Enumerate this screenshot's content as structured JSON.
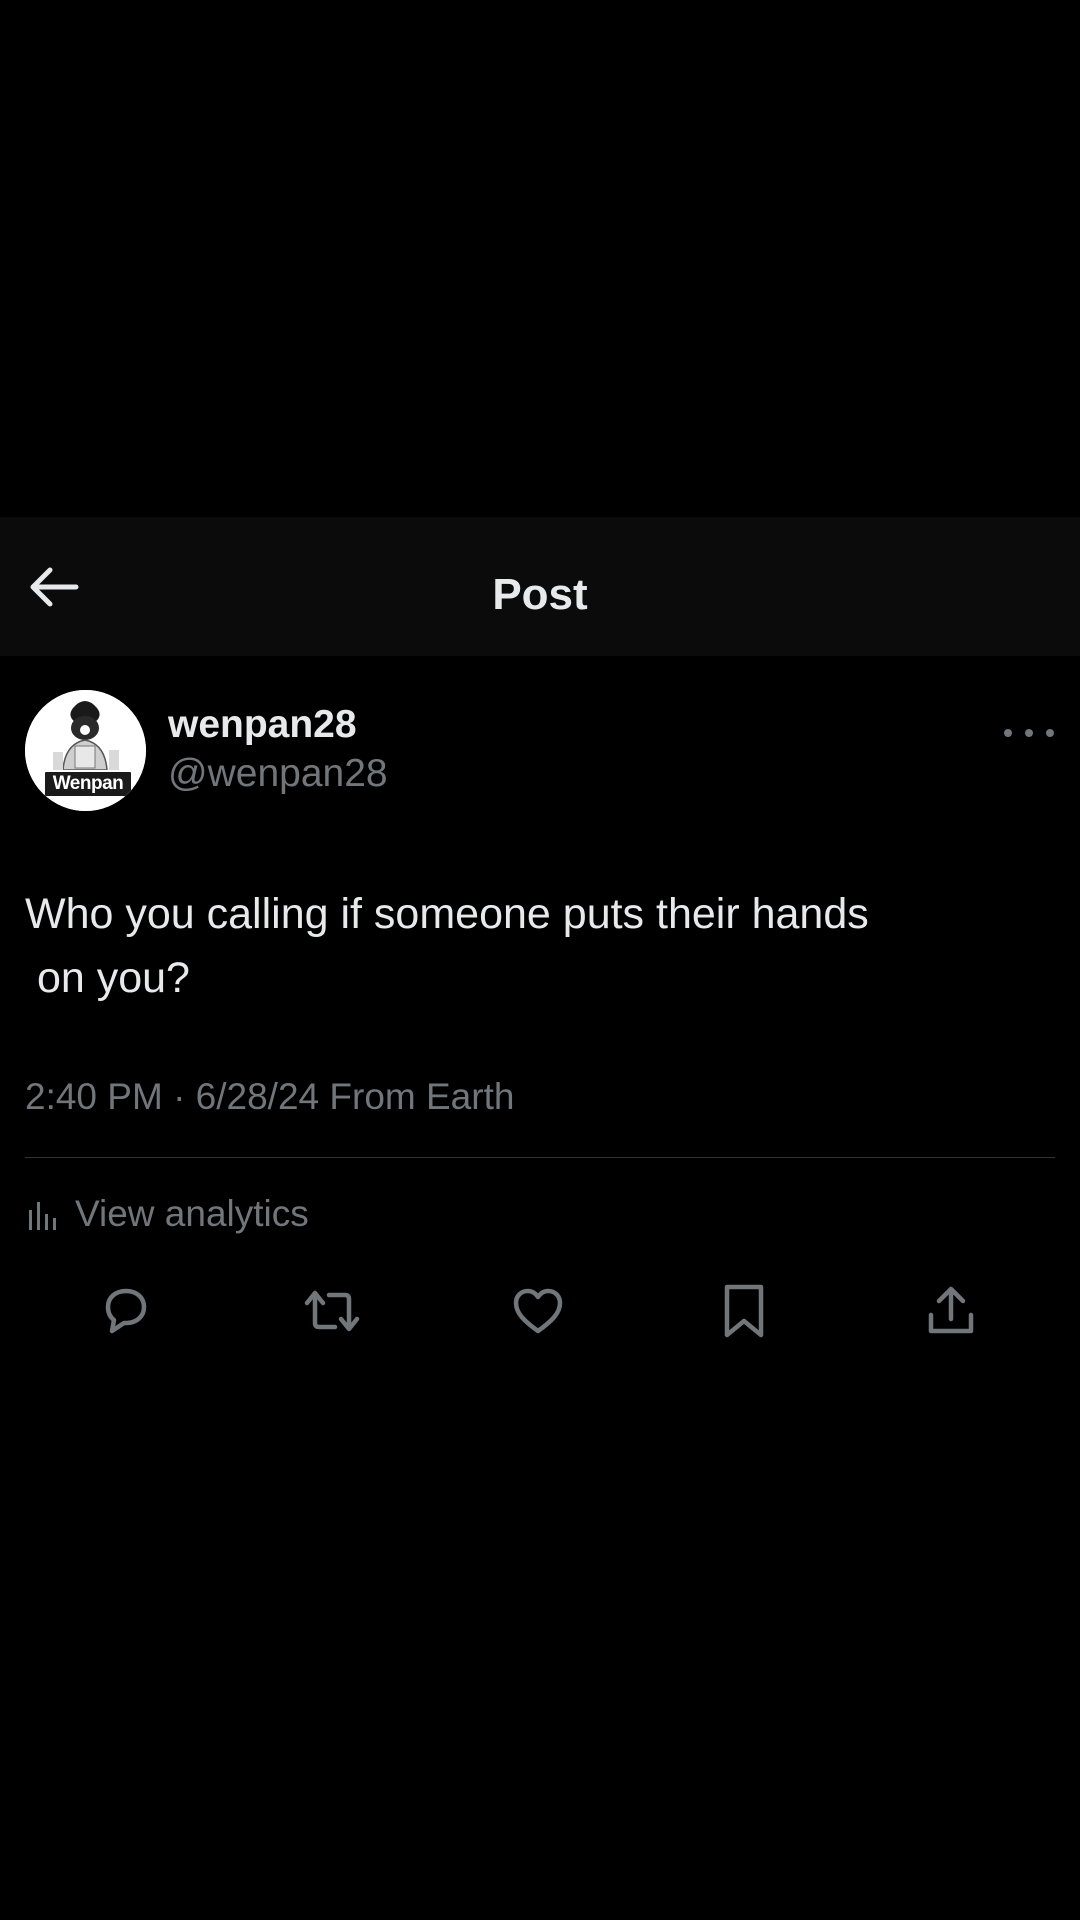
{
  "header": {
    "title": "Post",
    "back_icon": "arrow-left-icon"
  },
  "post": {
    "author": {
      "display_name": "wenpan28",
      "handle": "@wenpan28",
      "avatar_text": "Wenpan"
    },
    "text": "Who you calling if someone puts their hands\n on you?",
    "timestamp": "2:40 PM · 6/28/24 From Earth",
    "analytics_label": "View analytics",
    "more_icon": "more-dots-icon",
    "actions": [
      {
        "name": "reply",
        "icon": "reply-icon"
      },
      {
        "name": "repost",
        "icon": "repost-icon"
      },
      {
        "name": "like",
        "icon": "heart-icon"
      },
      {
        "name": "bookmark",
        "icon": "bookmark-icon"
      },
      {
        "name": "share",
        "icon": "share-icon"
      }
    ]
  },
  "colors": {
    "background": "#000000",
    "header_background": "#0b0b0b",
    "primary_text": "#e7e9ea",
    "secondary_text": "#71767b",
    "divider": "#2f3336"
  }
}
